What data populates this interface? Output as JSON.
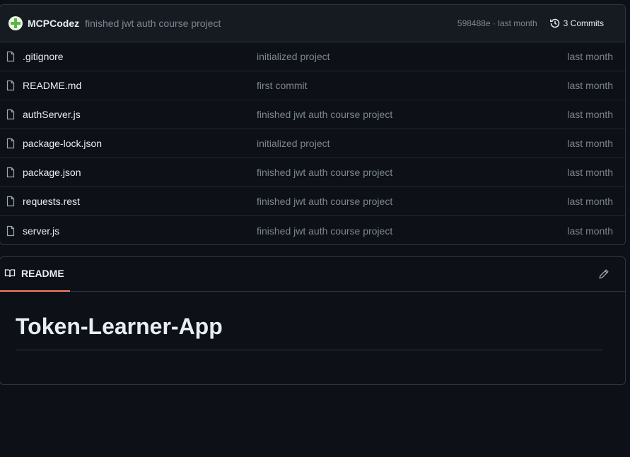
{
  "last_commit": {
    "author": "MCPCodez",
    "message": "finished jwt auth course project",
    "sha_time": "598488e · last month",
    "commits_label": "3 Commits",
    "avatar_icon": "identicon-avatar",
    "history_icon": "history-icon"
  },
  "files": [
    {
      "name": ".gitignore",
      "commit": "initialized project",
      "time": "last month"
    },
    {
      "name": "README.md",
      "commit": "first commit",
      "time": "last month"
    },
    {
      "name": "authServer.js",
      "commit": "finished jwt auth course project",
      "time": "last month"
    },
    {
      "name": "package-lock.json",
      "commit": "initialized project",
      "time": "last month"
    },
    {
      "name": "package.json",
      "commit": "finished jwt auth course project",
      "time": "last month"
    },
    {
      "name": "requests.rest",
      "commit": "finished jwt auth course project",
      "time": "last month"
    },
    {
      "name": "server.js",
      "commit": "finished jwt auth course project",
      "time": "last month"
    }
  ],
  "readme": {
    "tab_label": "README",
    "tab_icon": "book-icon",
    "edit_icon": "pencil-icon",
    "heading": "Token-Learner-App"
  },
  "colors": {
    "background": "#0d1117",
    "accent_tab": "#f78166",
    "muted_text": "#7d8590"
  }
}
